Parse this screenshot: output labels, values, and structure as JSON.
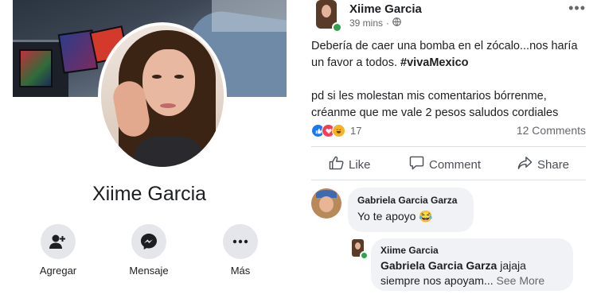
{
  "profile": {
    "name": "Xiime Garcia",
    "actions": [
      {
        "label": "Agregar",
        "icon": "add-friend-icon"
      },
      {
        "label": "Mensaje",
        "icon": "messenger-icon"
      },
      {
        "label": "Más",
        "icon": "more-icon"
      }
    ]
  },
  "post": {
    "author": "Xiime Garcia",
    "time": "39 mins",
    "separator": "·",
    "audience_icon": "globe-icon",
    "more": "•••",
    "text_line1": "Debería de caer una bomba en el zócalo...nos haría un favor a todos. ",
    "hashtag": "#vivaMexico",
    "text_line2": "pd si les molestan mis comentarios bórrenme, créanme que me vale 2 pesos  saludos cordiales",
    "reaction_count": "17",
    "reaction_icons": [
      "like-icon",
      "love-icon",
      "haha-icon"
    ],
    "comments_count": "12 Comments",
    "like_label": "Like",
    "comment_label": "Comment",
    "share_label": "Share"
  },
  "comments": [
    {
      "author": "Gabriela Garcia Garza",
      "text": "Yo te apoyo 😂"
    },
    {
      "author": "Xiime Garcia",
      "mention": "Gabriela Garcia Garza",
      "text": " jajaja siempre nos apoyam...",
      "see_more": " See More"
    }
  ],
  "colors": {
    "accent": "#1877f2",
    "secondary_text": "#65676b",
    "bubble": "#f0f2f5",
    "online": "#31a24c"
  }
}
